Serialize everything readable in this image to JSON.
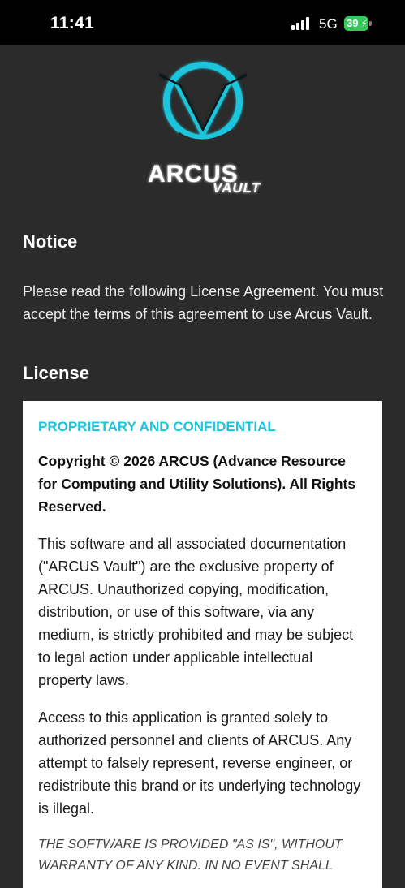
{
  "status_bar": {
    "time": "11:41",
    "network": "5G",
    "battery": "39"
  },
  "logo": {
    "brand": "ARCUS",
    "product": "VAULT",
    "accent_color": "#1cc4dc"
  },
  "notice": {
    "heading": "Notice",
    "body": "Please read the following License Agreement. You must accept the terms of this agreement to use Arcus Vault."
  },
  "license": {
    "heading": "License",
    "title": "PROPRIETARY AND CONFIDENTIAL",
    "copyright": "Copyright © 2026 ARCUS (Advance Resource for Computing and Utility Solutions). All Rights Reserved.",
    "paragraph_1": "This software and all associated documentation (\"ARCUS Vault\") are the exclusive property of ARCUS. Unauthorized copying, modification, distribution, or use of this software, via any medium, is strictly prohibited and may be subject to legal action under applicable intellectual property laws.",
    "paragraph_2": "Access to this application is granted solely to authorized personnel and clients of ARCUS. Any attempt to falsely represent, reverse engineer, or redistribute this brand or its underlying technology is illegal.",
    "warranty": "THE SOFTWARE IS PROVIDED \"AS IS\", WITHOUT WARRANTY OF ANY KIND. IN NO EVENT SHALL"
  }
}
